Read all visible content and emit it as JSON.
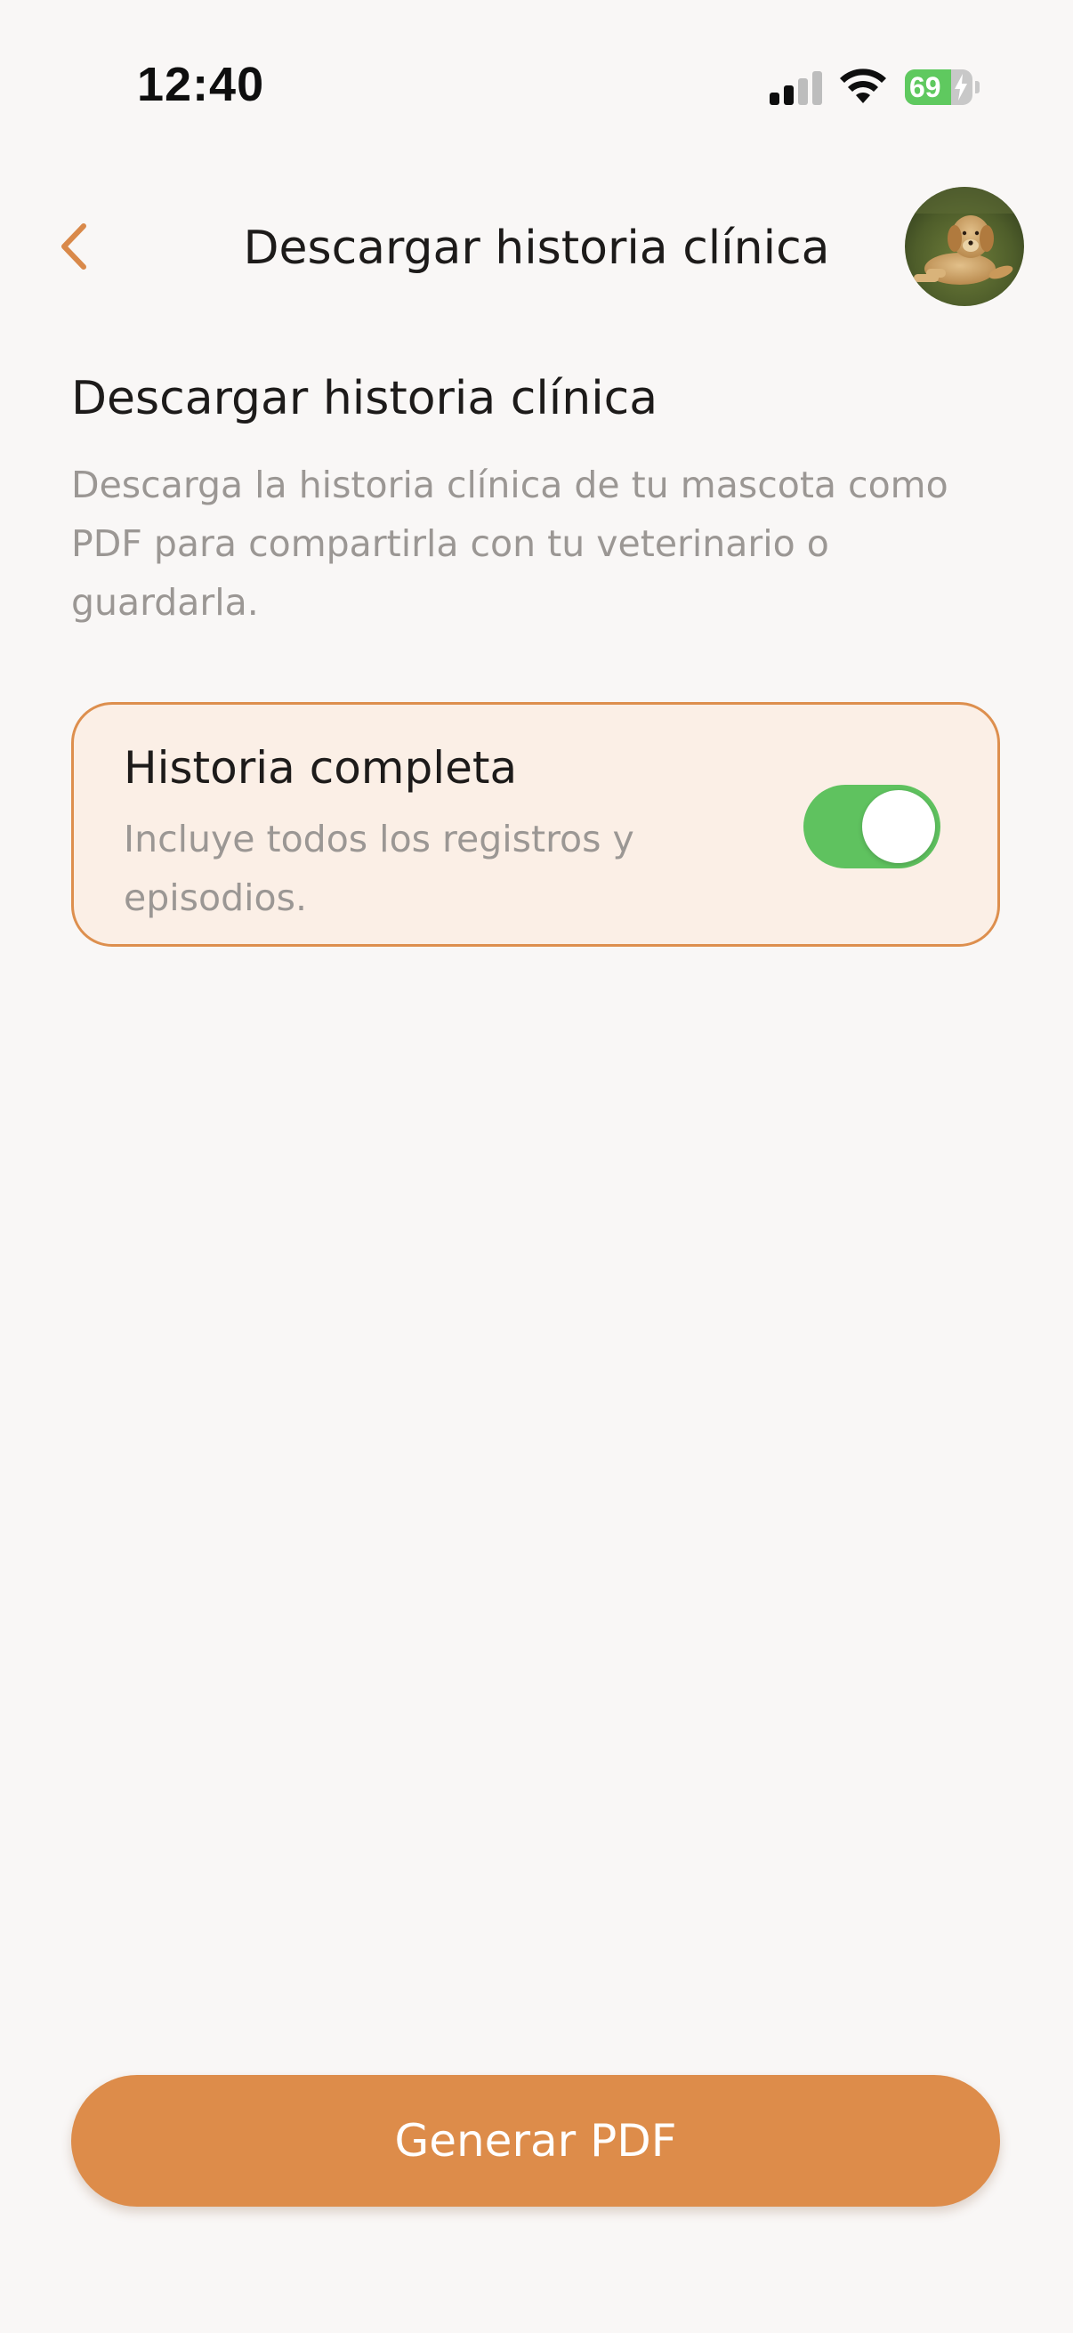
{
  "status_bar": {
    "time": "12:40",
    "battery_percent": "69",
    "battery_level": 0.69,
    "signal_bars_active": 2,
    "signal_bars_total": 4
  },
  "nav": {
    "title": "Descargar historia clínica",
    "back_icon": "chevron-left-icon",
    "avatar_description": "pet-avatar"
  },
  "section": {
    "title": "Descargar historia clínica",
    "description": "Descarga la historia clínica de tu mascota como PDF para compartirla con tu veterinario o guardarla."
  },
  "option": {
    "title": "Historia completa",
    "description": "Incluye todos los registros y episodios.",
    "toggle_on": true
  },
  "actions": {
    "generate_label": "Generar PDF"
  },
  "colors": {
    "accent": "#dd8c4a",
    "card_bg": "#fbefe6",
    "toggle_on": "#5fc25f",
    "background": "#f9f7f6"
  }
}
